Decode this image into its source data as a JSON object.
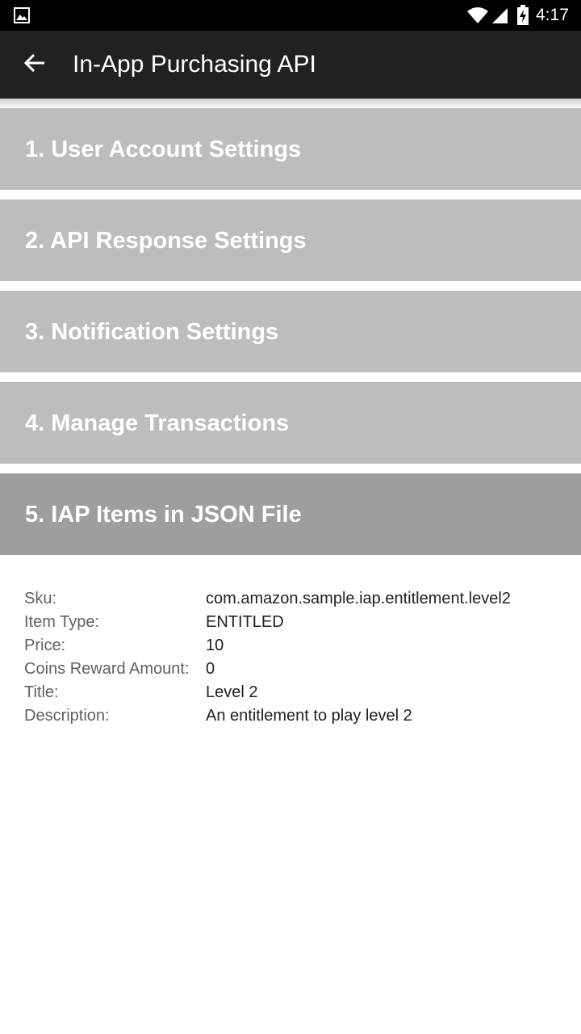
{
  "status_bar": {
    "time": "4:17",
    "icons": [
      "image-icon",
      "wifi-icon",
      "signal-icon",
      "battery-icon"
    ]
  },
  "app_bar": {
    "title": "In-App Purchasing API",
    "back_icon": "arrow-back-icon"
  },
  "sections": [
    {
      "label": "1. User Account Settings",
      "active": false
    },
    {
      "label": "2. API Response Settings",
      "active": false
    },
    {
      "label": "3. Notification Settings",
      "active": false
    },
    {
      "label": "4. Manage Transactions",
      "active": false
    },
    {
      "label": "5. IAP Items in JSON File",
      "active": true
    }
  ],
  "item_details": [
    {
      "key": "Sku:",
      "value": "com.amazon.sample.iap.entitlement.level2"
    },
    {
      "key": "Item Type:",
      "value": "ENTITLED"
    },
    {
      "key": "Price:",
      "value": "10"
    },
    {
      "key": "Coins Reward Amount:",
      "value": "0"
    },
    {
      "key": "Title:",
      "value": "Level 2"
    },
    {
      "key": "Description:",
      "value": "An entitlement to play level 2"
    }
  ],
  "colors": {
    "status_bar": "#000000",
    "app_bar": "#212121",
    "section": "#bdbdbd",
    "section_active": "#9e9e9e"
  }
}
